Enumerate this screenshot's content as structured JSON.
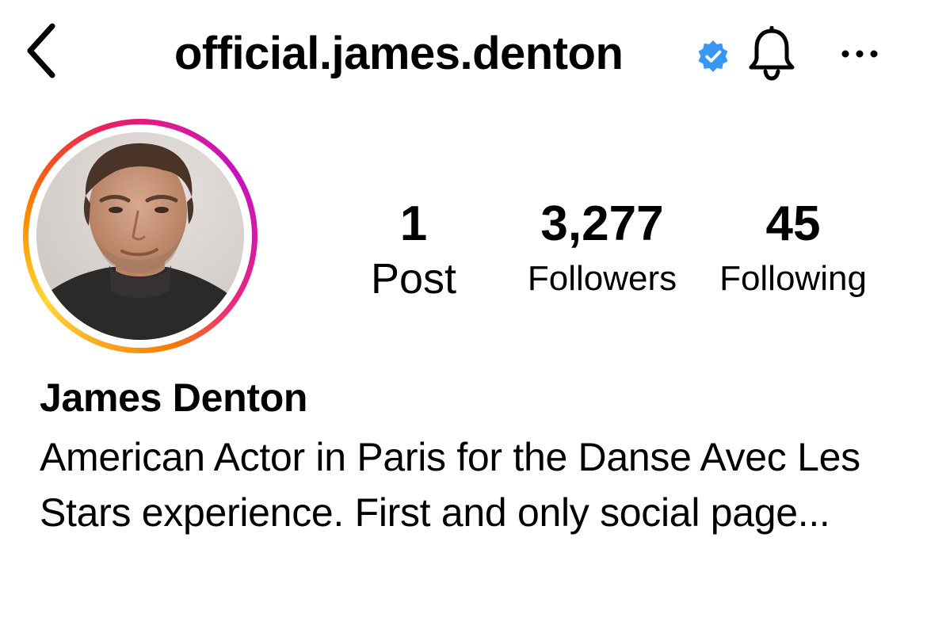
{
  "header": {
    "username": "official.james.denton",
    "back_icon": "chevron-left-icon",
    "verified_icon": "verified-badge-icon",
    "bell_icon": "bell-icon",
    "more_icon": "ellipsis-icon",
    "verified_color": "#3897f0"
  },
  "profile": {
    "avatar_ring_colors": [
      "#f9a825",
      "#f4511e",
      "#e91e63",
      "#c513c0"
    ],
    "stats": {
      "posts": {
        "count": "1",
        "label": "Post"
      },
      "followers": {
        "count": "3,277",
        "label": "Followers"
      },
      "following": {
        "count": "45",
        "label": "Following"
      }
    },
    "full_name": "James Denton",
    "bio": "American Actor in Paris for the Danse Avec Les Stars experience. First and only social page..."
  }
}
